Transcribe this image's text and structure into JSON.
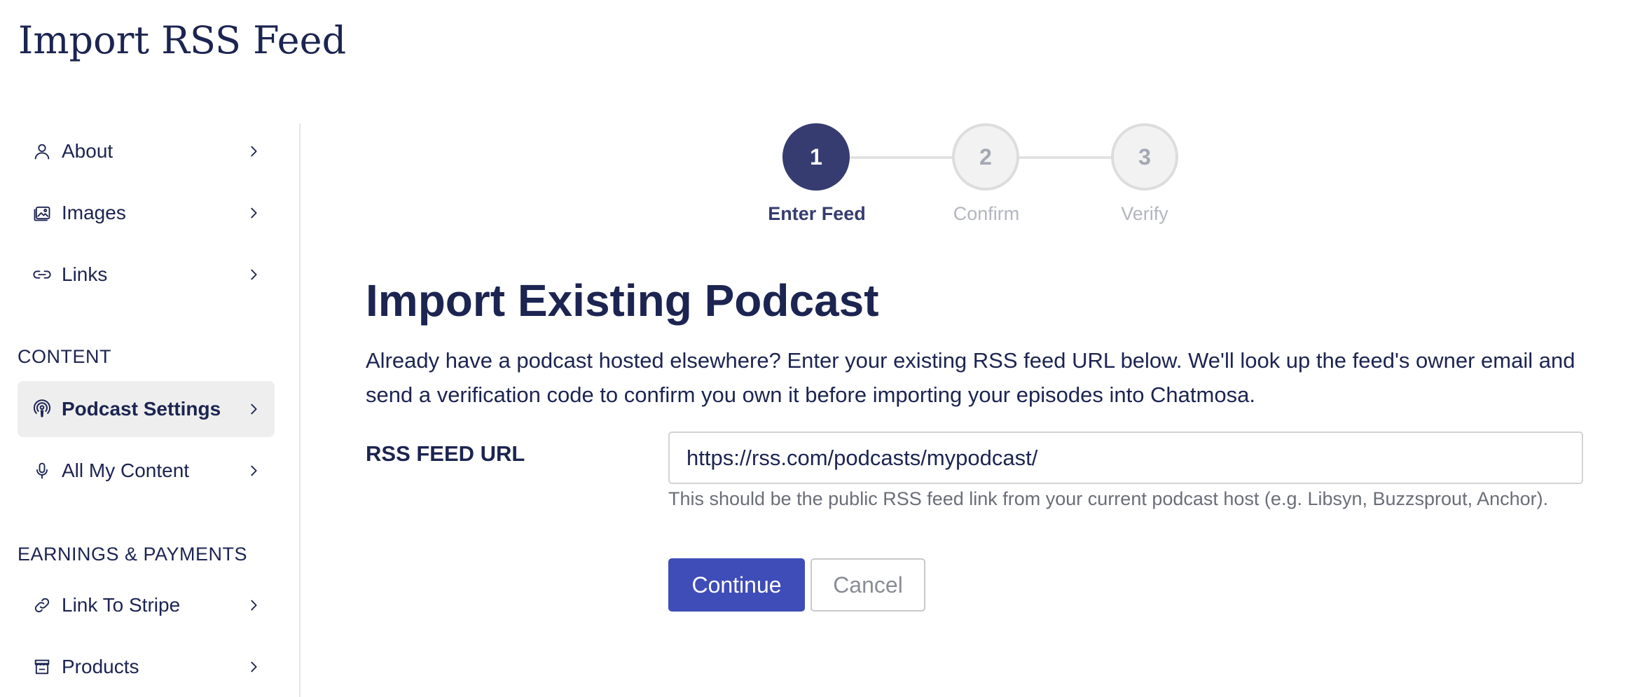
{
  "page": {
    "title": "Import RSS Feed"
  },
  "sidebar": {
    "items": [
      {
        "label": "About",
        "icon": "user-icon"
      },
      {
        "label": "Images",
        "icon": "images-icon"
      },
      {
        "label": "Links",
        "icon": "link-icon"
      }
    ],
    "content_heading": "CONTENT",
    "content_items": [
      {
        "label": "Podcast Settings",
        "icon": "podcast-icon",
        "active": true
      },
      {
        "label": "All My Content",
        "icon": "microphone-icon",
        "active": false
      }
    ],
    "earnings_heading": "EARNINGS & PAYMENTS",
    "earnings_items": [
      {
        "label": "Link To Stripe",
        "icon": "link-icon"
      },
      {
        "label": "Products",
        "icon": "store-icon"
      }
    ]
  },
  "stepper": {
    "steps": [
      {
        "number": "1",
        "label": "Enter Feed",
        "state": "active"
      },
      {
        "number": "2",
        "label": "Confirm",
        "state": "inactive"
      },
      {
        "number": "3",
        "label": "Verify",
        "state": "inactive"
      }
    ]
  },
  "main": {
    "heading": "Import Existing Podcast",
    "description": "Already have a podcast hosted elsewhere? Enter your existing RSS feed URL below. We'll look up the feed's owner email and send a verification code to confirm you own it before importing your episodes into Chatmosa.",
    "field_label": "RSS FEED URL",
    "url_value": "https://rss.com/podcasts/mypodcast/",
    "hint": "This should be the public RSS feed link from your current podcast host (e.g. Libsyn, Buzzsprout, Anchor).",
    "continue_label": "Continue",
    "cancel_label": "Cancel"
  },
  "colors": {
    "navy": "#1c2451",
    "step_active": "#363c70",
    "primary_button": "#3f4db8",
    "active_nav_bg": "#eeeeee"
  }
}
